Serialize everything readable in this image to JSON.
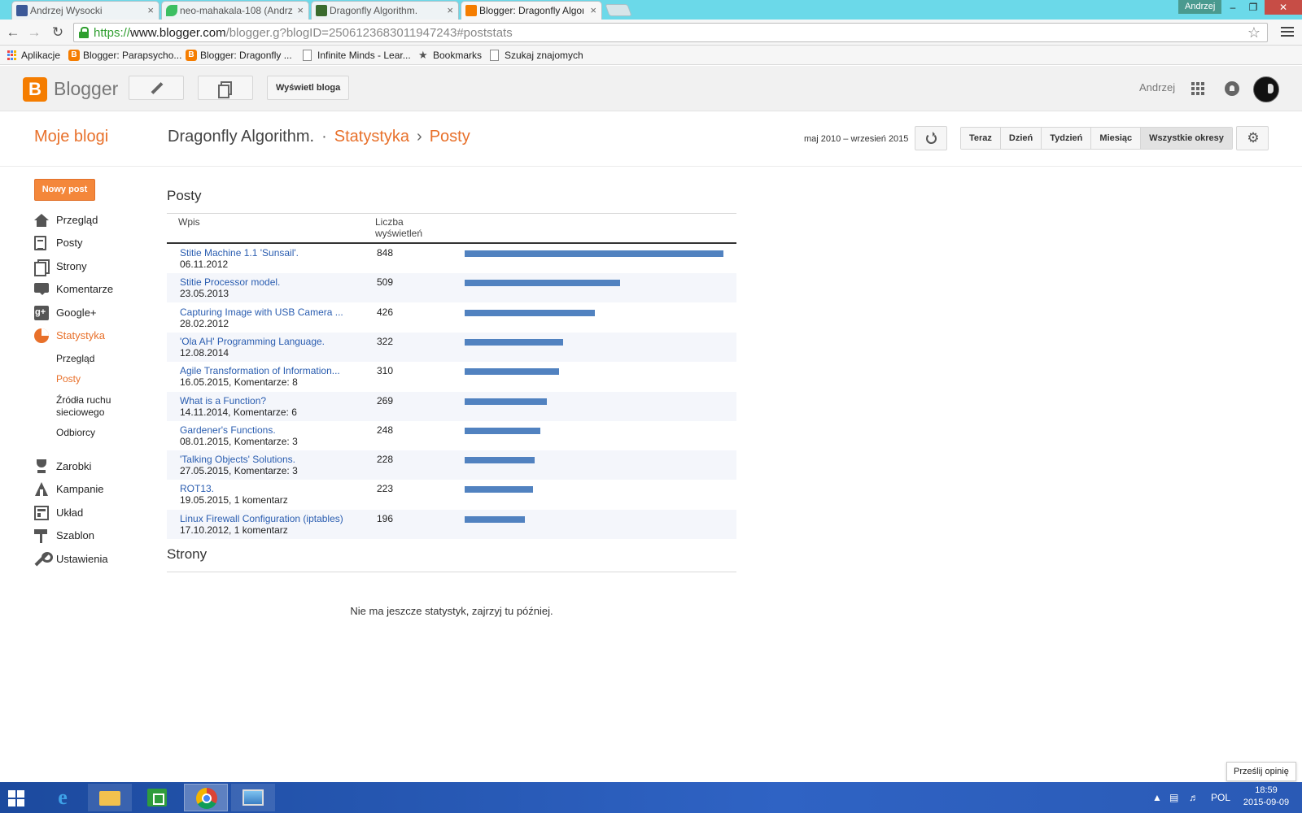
{
  "browser": {
    "tabs": [
      {
        "label": "Andrzej Wysocki",
        "favicon_color": "#3b5998"
      },
      {
        "label": "neo-mahakala-108 (Andrz",
        "favicon_color": "#3cbf62"
      },
      {
        "label": "Dragonfly Algorithm.",
        "favicon_color": "#3a6b2e"
      },
      {
        "label": "Blogger: Dragonfly Algorit",
        "favicon_color": "#f57d00"
      }
    ],
    "tab_close_glyph": "×",
    "profile_name": "Andrzej",
    "window_controls": {
      "minimize": "–",
      "restore": "❐",
      "close": "✕"
    },
    "url": {
      "scheme": "https://",
      "host": "www.blogger.com",
      "path": "/blogger.g?blogID=2506123683011947243#poststats"
    },
    "bookmarks": [
      {
        "label": "Aplikacje",
        "icon": "apps-icon"
      },
      {
        "label": "Blogger: Parapsycho...",
        "icon": "blogger-icon"
      },
      {
        "label": "Blogger: Dragonfly ...",
        "icon": "blogger-icon"
      },
      {
        "label": "Infinite Minds - Lear...",
        "icon": "page-icon"
      },
      {
        "label": "Bookmarks",
        "icon": "star-icon"
      },
      {
        "label": "Szukaj znajomych",
        "icon": "page-icon"
      }
    ]
  },
  "header": {
    "logo_text": "Blogger",
    "view_blog_label": "Wyświetl bloga",
    "username": "Andrzej"
  },
  "titlebar": {
    "my_blogs": "Moje blogi",
    "blog_name": "Dragonfly Algorithm.",
    "dot": "·",
    "crumb_stats": "Statystyka",
    "chevron": "›",
    "crumb_posts": "Posty",
    "date_range": "maj 2010 – wrzesień 2015",
    "periods": [
      {
        "label": "Teraz",
        "selected": false
      },
      {
        "label": "Dzień",
        "selected": false
      },
      {
        "label": "Tydzień",
        "selected": false
      },
      {
        "label": "Miesiąc",
        "selected": false
      },
      {
        "label": "Wszystkie okresy",
        "selected": true
      }
    ]
  },
  "sidebar": {
    "new_post": "Nowy post",
    "items": [
      {
        "label": "Przegląd",
        "icon": "home-icon",
        "active": false
      },
      {
        "label": "Posty",
        "icon": "posts-icon",
        "active": false
      },
      {
        "label": "Strony",
        "icon": "pages-icon",
        "active": false
      },
      {
        "label": "Komentarze",
        "icon": "comments-icon",
        "active": false
      },
      {
        "label": "Google+",
        "icon": "google-plus-icon",
        "active": false
      },
      {
        "label": "Statystyka",
        "icon": "stats-icon",
        "active": true
      }
    ],
    "stats_sub": [
      {
        "label": "Przegląd",
        "active": false
      },
      {
        "label": "Posty",
        "active": true
      },
      {
        "label": "Źródła ruchu",
        "label2": "sieciowego",
        "active": false
      },
      {
        "label": "Odbiorcy",
        "active": false
      }
    ],
    "items2": [
      {
        "label": "Zarobki",
        "icon": "trophy-icon"
      },
      {
        "label": "Kampanie",
        "icon": "campaigns-icon"
      },
      {
        "label": "Układ",
        "icon": "layout-icon"
      },
      {
        "label": "Szablon",
        "icon": "template-icon"
      },
      {
        "label": "Ustawienia",
        "icon": "wrench-icon"
      }
    ]
  },
  "main": {
    "posts_title": "Posty",
    "col_entry": "Wpis",
    "col_views_1": "Liczba",
    "col_views_2": "wyświetleń",
    "bar_color": "#5182c0",
    "posts": [
      {
        "title": "Stitie Machine 1.1 'Sunsail'.",
        "meta": "06.11.2012",
        "views": 848
      },
      {
        "title": "Stitie Processor model.",
        "meta": "23.05.2013",
        "views": 509
      },
      {
        "title": "Capturing Image with USB Camera ...",
        "meta": "28.02.2012",
        "views": 426
      },
      {
        "title": "'Ola AH' Programming Language.",
        "meta": "12.08.2014",
        "views": 322
      },
      {
        "title": "Agile Transformation of Information...",
        "meta": "16.05.2015, Komentarze: 8",
        "views": 310
      },
      {
        "title": "What is a Function?",
        "meta": "14.11.2014, Komentarze: 6",
        "views": 269
      },
      {
        "title": "Gardener's Functions.",
        "meta": "08.01.2015, Komentarze: 3",
        "views": 248
      },
      {
        "title": "'Talking Objects' Solutions.",
        "meta": "27.05.2015, Komentarze: 3",
        "views": 228
      },
      {
        "title": "ROT13.",
        "meta": "19.05.2015, 1 komentarz",
        "views": 223
      },
      {
        "title": "Linux Firewall Configuration (iptables)",
        "meta": "17.10.2012, 1 komentarz",
        "views": 196
      }
    ],
    "pages_title": "Strony",
    "pages_empty": "Nie ma jeszcze statystyk, zajrzyj tu później."
  },
  "feedback_label": "Prześlij opinię",
  "taskbar": {
    "lang": "POL",
    "time": "18:59",
    "date": "2015-09-09"
  }
}
